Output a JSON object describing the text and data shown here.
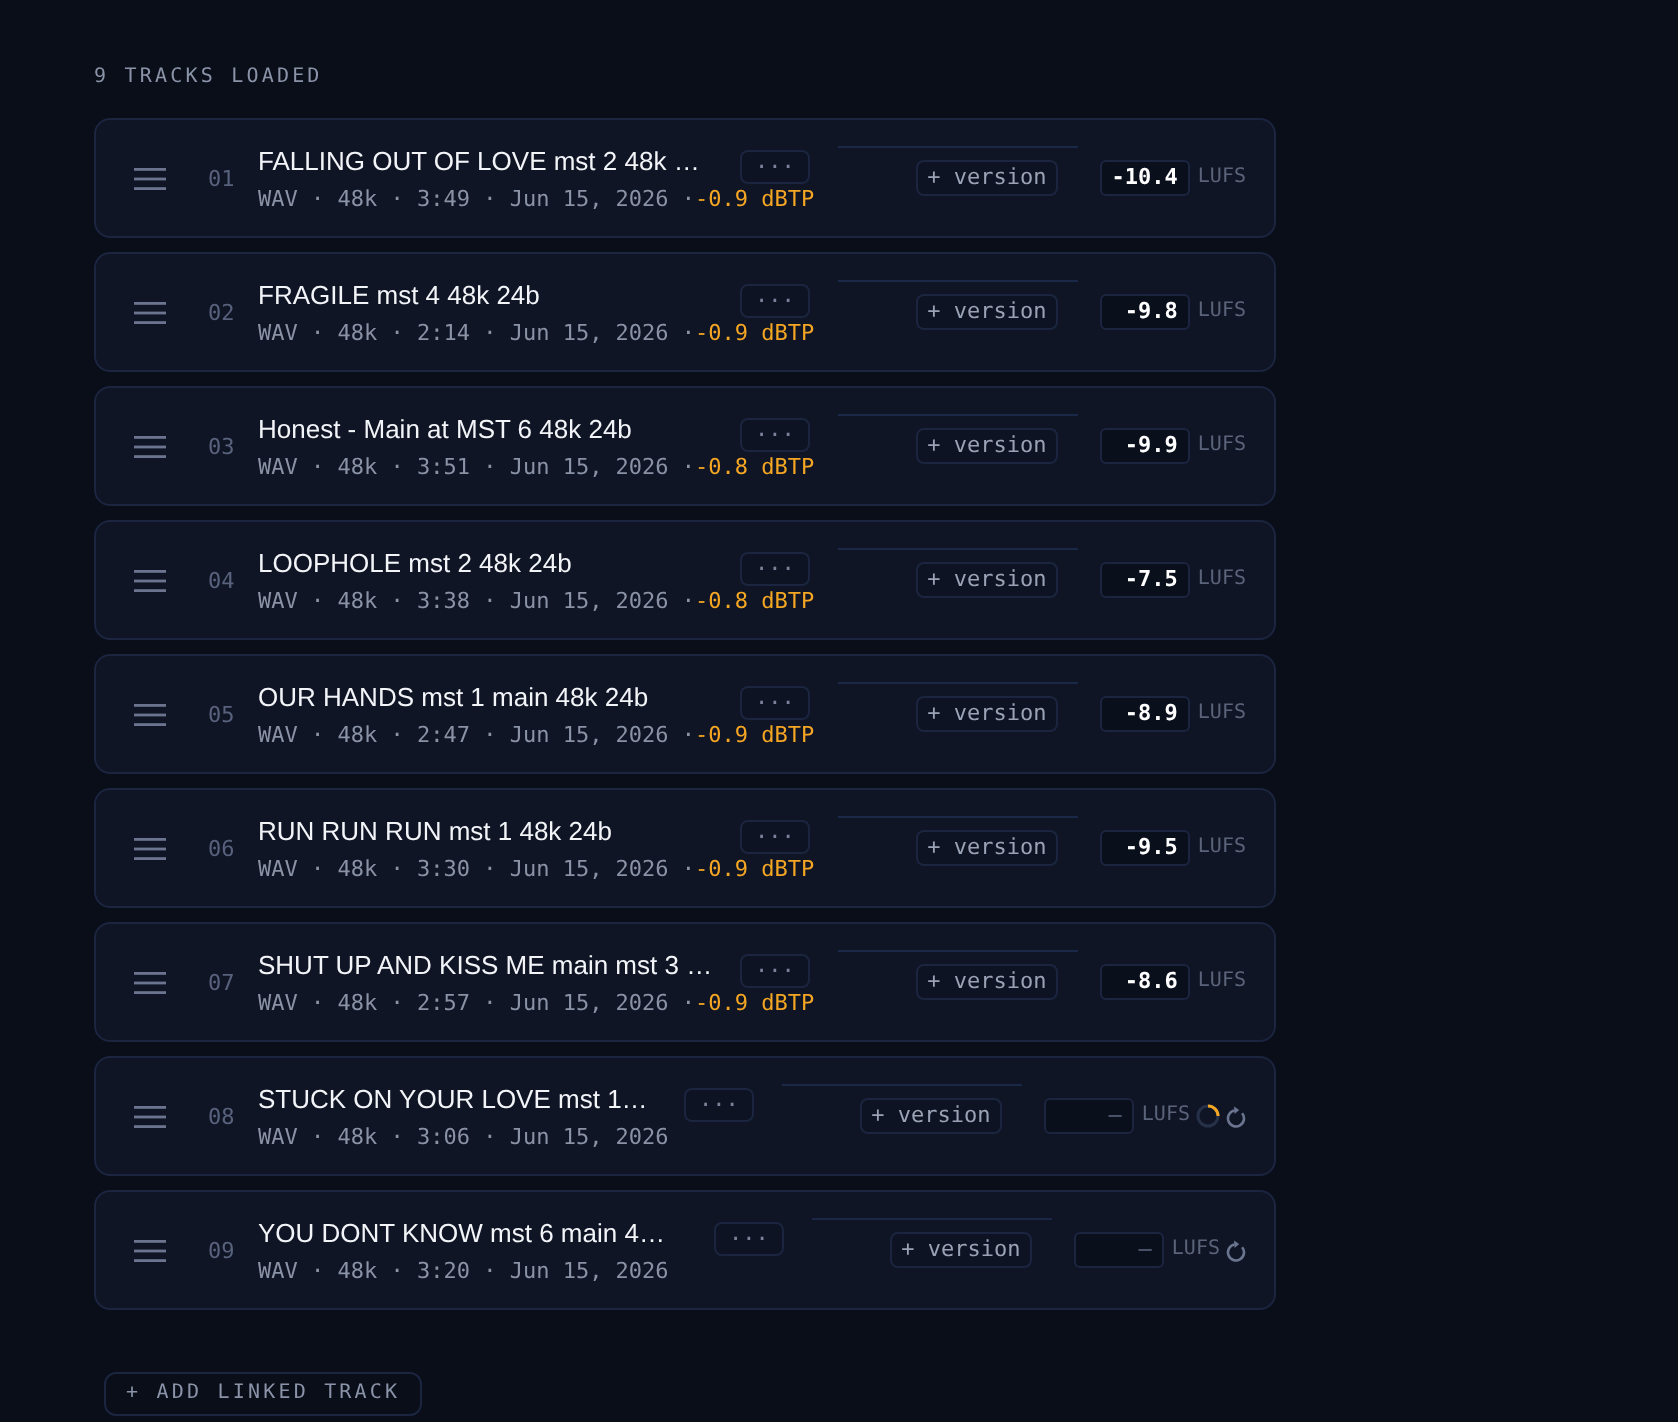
{
  "header": {
    "label": "9 TRACKS LOADED"
  },
  "tracks": [
    {
      "number": "01",
      "title": "FALLING OUT OF LOVE mst 2 48k …",
      "meta": "WAV · 48k · 3:49 · Jun 15, 2026 ·",
      "true_peak": "-0.9 dBTP",
      "more_label": "···",
      "version_label": "+ version",
      "loudness": "-10.4",
      "measured": true,
      "loudness_unit": "LUFS",
      "loading": false,
      "retry": false
    },
    {
      "number": "02",
      "title": "FRAGILE mst 4 48k 24b",
      "meta": "WAV · 48k · 2:14 · Jun 15, 2026 ·",
      "true_peak": "-0.9 dBTP",
      "more_label": "···",
      "version_label": "+ version",
      "loudness": "-9.8",
      "measured": true,
      "loudness_unit": "LUFS",
      "loading": false,
      "retry": false
    },
    {
      "number": "03",
      "title": "Honest - Main at MST 6 48k 24b",
      "meta": "WAV · 48k · 3:51 · Jun 15, 2026 ·",
      "true_peak": "-0.8 dBTP",
      "more_label": "···",
      "version_label": "+ version",
      "loudness": "-9.9",
      "measured": true,
      "loudness_unit": "LUFS",
      "loading": false,
      "retry": false
    },
    {
      "number": "04",
      "title": "LOOPHOLE mst 2 48k 24b",
      "meta": "WAV · 48k · 3:38 · Jun 15, 2026 ·",
      "true_peak": "-0.8 dBTP",
      "more_label": "···",
      "version_label": "+ version",
      "loudness": "-7.5",
      "measured": true,
      "loudness_unit": "LUFS",
      "loading": false,
      "retry": false
    },
    {
      "number": "05",
      "title": "OUR HANDS mst 1 main 48k 24b",
      "meta": "WAV · 48k · 2:47 · Jun 15, 2026 ·",
      "true_peak": "-0.9 dBTP",
      "more_label": "···",
      "version_label": "+ version",
      "loudness": "-8.9",
      "measured": true,
      "loudness_unit": "LUFS",
      "loading": false,
      "retry": false
    },
    {
      "number": "06",
      "title": "RUN RUN RUN mst 1 48k 24b",
      "meta": "WAV · 48k · 3:30 · Jun 15, 2026 ·",
      "true_peak": "-0.9 dBTP",
      "more_label": "···",
      "version_label": "+ version",
      "loudness": "-9.5",
      "measured": true,
      "loudness_unit": "LUFS",
      "loading": false,
      "retry": false
    },
    {
      "number": "07",
      "title": "SHUT UP AND KISS ME main mst 3 …",
      "meta": "WAV · 48k · 2:57 · Jun 15, 2026 ·",
      "true_peak": "-0.9 dBTP",
      "more_label": "···",
      "version_label": "+ version",
      "loudness": "-8.6",
      "measured": true,
      "loudness_unit": "LUFS",
      "loading": false,
      "retry": false
    },
    {
      "number": "08",
      "title": "STUCK ON YOUR LOVE mst 1…",
      "meta": "WAV · 48k · 3:06 · Jun 15, 2026",
      "more_label": "···",
      "version_label": "+ version",
      "loudness": "—",
      "measured": false,
      "loudness_unit": "LUFS",
      "loading": true,
      "retry": true
    },
    {
      "number": "09",
      "title": "YOU DONT KNOW mst 6 main 4…",
      "meta": "WAV · 48k · 3:20 · Jun 15, 2026",
      "more_label": "···",
      "version_label": "+ version",
      "loudness": "—",
      "measured": false,
      "loudness_unit": "LUFS",
      "loading": false,
      "retry": true
    }
  ],
  "add_button": {
    "label": "+ ADD LINKED TRACK"
  }
}
